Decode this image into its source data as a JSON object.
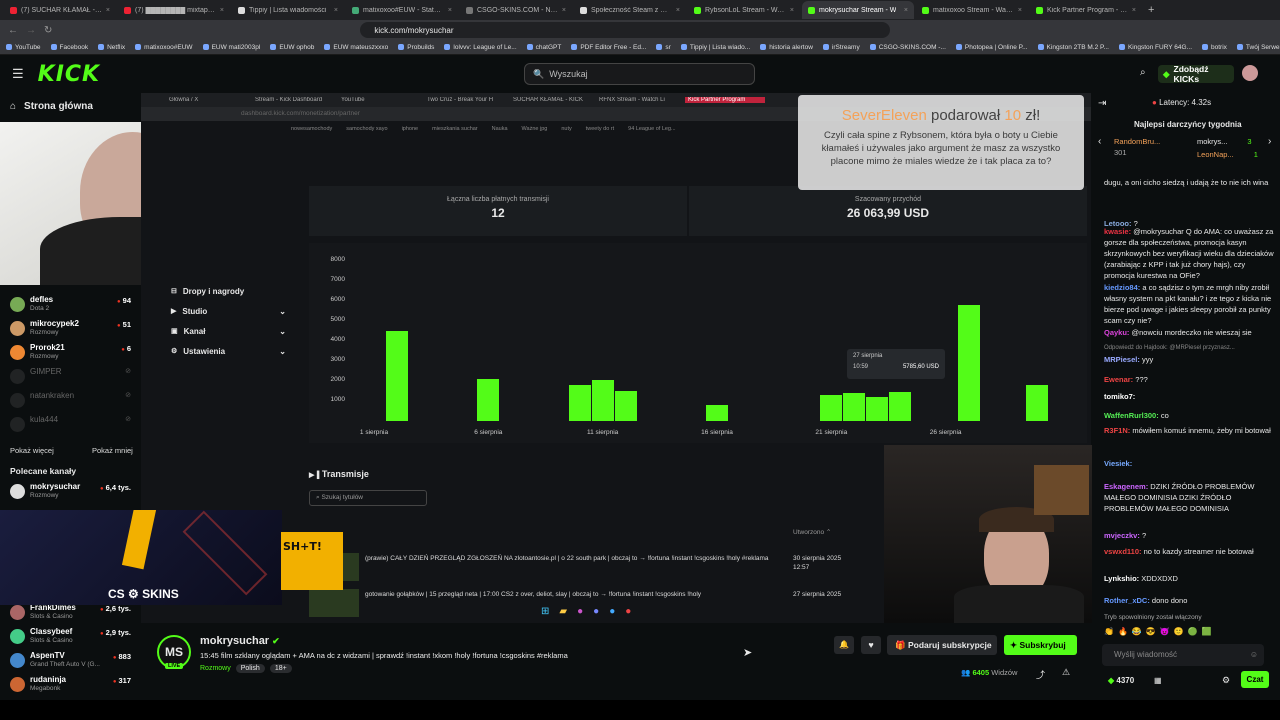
{
  "browser": {
    "tabs": [
      {
        "label": "(7) SUCHAR KŁAMAŁ - KICK PLAY",
        "color": "#e23",
        "active": false
      },
      {
        "label": "(7) ████████ mixtape do",
        "color": "#e23",
        "active": false
      },
      {
        "label": "Tippiy | Lista wiadomości",
        "color": "#ddd",
        "active": false
      },
      {
        "label": "matixoxoo#EUW - Statystyki gry",
        "color": "#4a7",
        "active": false
      },
      {
        "label": "CSGO-SKINS.COM - Najlepsze S",
        "color": "#777",
        "active": false
      },
      {
        "label": "Społeczność Steam z matixoxo",
        "color": "#ddd",
        "active": false
      },
      {
        "label": "RybsonLoL Stream - Watch Live",
        "color": "#53fc18",
        "active": false
      },
      {
        "label": "mokrysuchar Stream - W",
        "color": "#53fc18",
        "active": true
      },
      {
        "label": "matixoxoo Stream - Watch Live",
        "color": "#53fc18",
        "active": false
      },
      {
        "label": "Kick Partner Program - Kick Da",
        "color": "#53fc18",
        "active": false
      }
    ],
    "url": "kick.com/mokrysuchar",
    "bookmarks": [
      "YouTube",
      "Facebook",
      "Netflix",
      "matixoxoo#EUW",
      "EUW mati2003pl",
      "EUW ophob",
      "EUW mateuszxxxo",
      "Probuilds",
      "lolvvv: League of Le...",
      "chatGPT",
      "PDF Editor Free - Ed...",
      "sr",
      "Tippiy | Lista wiado...",
      "historia alertow",
      "irStreamy",
      "CSGO-SKINS.COM -...",
      "Photopea | Online P...",
      "Kingston 2TB M.2 P...",
      "Kingston FURY 64G...",
      "botrix",
      "Twój Serwer - SkillH..."
    ]
  },
  "topbar": {
    "logo": "KICK",
    "search_placeholder": "Wyszukaj",
    "get_kicks": "Zdobądź KICKs"
  },
  "sidebar": {
    "home": "Strona główna",
    "followed": [
      {
        "name": "defles",
        "category": "Dota 2",
        "viewers": "94",
        "color": "#7a5"
      },
      {
        "name": "mikrocypek2",
        "category": "Rozmowy",
        "viewers": "51",
        "color": "#c96"
      },
      {
        "name": "Prorok21",
        "category": "Rozmowy",
        "viewers": "6",
        "color": "#e83"
      },
      {
        "name": "GIMPER",
        "category": "",
        "viewers": "",
        "color": "#444"
      },
      {
        "name": "natankraken",
        "category": "",
        "viewers": "",
        "color": "#444"
      },
      {
        "name": "kula444",
        "category": "",
        "viewers": "",
        "color": "#444"
      }
    ],
    "show_more": "Pokaż więcej",
    "show_less": "Pokaż mniej",
    "recommended_title": "Polecane kanały",
    "recommended": [
      {
        "name": "mokrysuchar",
        "category": "Rozmowy",
        "viewers": "6,4 tys.",
        "color": "#ddd"
      },
      {
        "name": "FrankDimes",
        "category": "Slots & Casino",
        "viewers": "2,6 tys.",
        "color": "#a66"
      },
      {
        "name": "Classybeef",
        "category": "Slots & Casino",
        "viewers": "2,9 tys.",
        "color": "#4c8"
      },
      {
        "name": "AspenTV",
        "category": "Grand Theft Auto V (G...",
        "viewers": "883",
        "color": "#48c"
      },
      {
        "name": "rudaninja",
        "category": "Megabonk",
        "viewers": "317",
        "color": "#c63"
      }
    ]
  },
  "screen": {
    "tabs": [
      "Główna / X",
      "Stream - Kick Dashboard",
      "YouTube",
      "Two Cruz - Break Your H",
      "SUCHAR KŁAMAŁ - KICK",
      "RFNX Stream - Watch Li",
      "Kick Partner Program"
    ],
    "url": "dashboard.kick.com/monetization/partner",
    "bookmarks": [
      "nowesamochody",
      "samochody xayo",
      "iphone",
      "mieszkania suchar",
      "Nauka",
      "Ważne jpg",
      "nuty",
      "tweety do rt",
      "94 League of Leg..."
    ],
    "menu": [
      "Dropy i nagrody",
      "Studio",
      "Kanał",
      "Ustawienia"
    ],
    "stat1_label": "Łączna liczba płatnych transmisji",
    "stat1_value": "12",
    "stat2_label": "Szacowany przychód",
    "stat2_value": "26 063,99 USD",
    "tooltip_date": "27 sierpnia",
    "tooltip_time": "10:59",
    "tooltip_value": "5785,60 USD",
    "transmisje_title": "Transmisje",
    "search_titles": "Szukaj tytułów",
    "created_header": "Utworzono",
    "streams": [
      {
        "title": "(prawie) CAŁY DZIEŃ PRZEGLĄD ZGŁOSZEŃ NA zlotoantosie.pl | o 22 south park | obczaj to → !fortuna !instant !csgoskins !holy #reklama",
        "date": "30 sierpnia 2025",
        "time": "12:57"
      },
      {
        "title": "gotowanie gołąbków | 15 przegląd neta | 17:00 CS2 z over, deliot, slay | obczaj to → !fortuna !instant !csgoskins !holy",
        "date": "27 sierpnia 2025",
        "time": ""
      }
    ]
  },
  "chart_data": {
    "type": "bar",
    "title": "",
    "xlabel": "",
    "ylabel": "",
    "ylim": [
      0,
      8000
    ],
    "yticks": [
      1000,
      2000,
      3000,
      4000,
      5000,
      6000,
      7000,
      8000
    ],
    "xtick_labels": [
      "1 sierpnia",
      "6 sierpnia",
      "11 sierpnia",
      "16 sierpnia",
      "21 sierpnia",
      "26 sierpnia"
    ],
    "series": [
      {
        "values": [
          {
            "day": 2,
            "value": 4500
          },
          {
            "day": 6,
            "value": 2100
          },
          {
            "day": 10,
            "value": 1800
          },
          {
            "day": 11,
            "value": 2050
          },
          {
            "day": 12,
            "value": 1500
          },
          {
            "day": 16,
            "value": 800
          },
          {
            "day": 21,
            "value": 1300
          },
          {
            "day": 22,
            "value": 1400
          },
          {
            "day": 23,
            "value": 1200
          },
          {
            "day": 24,
            "value": 1450
          },
          {
            "day": 27,
            "value": 5785.6
          },
          {
            "day": 30,
            "value": 1800
          }
        ]
      }
    ]
  },
  "donation": {
    "name": "SeverEleven",
    "action": "podarował",
    "amount": "10",
    "currency": "zł!",
    "message": "Czyli cała spine z Rybsonem, która była o boty u Ciebie kłamałeś i używales jako argument że masz za wszystko placone mimo że miales wiedze że i tak placa za to?"
  },
  "overlay": {
    "logo": "CS",
    "skins": "SKINS"
  },
  "stream": {
    "channel": "mokrysuchar",
    "avatar_initials": "MS",
    "live_badge": "LIVE",
    "title": "15:45 film szklany oglądam + AMA na dc z widzami | sprawdź !instant !xkom !holy !fortuna !csgoskins #reklama",
    "category": "Rozmowy",
    "tags": [
      "Polish",
      "18+"
    ],
    "gift_label": "Podaruj subskrypcje",
    "subscribe_label": "Subskrybuj",
    "viewers": "6405",
    "viewers_label": "Widzów"
  },
  "chat": {
    "latency": "Latency: 4.32s",
    "top_title": "Najlepsi darczyńcy tygodnia",
    "top": [
      {
        "name": "RandomBru...",
        "value": "301"
      },
      {
        "name": "mokrys...",
        "value": "3"
      },
      {
        "name": "LeonNap...",
        "value": "1"
      }
    ],
    "messages": [
      {
        "user": "",
        "color": "#fff",
        "text": "dugu, a oni cicho siedzą i udają że to nie ich wina"
      },
      {
        "user": "Letooo:",
        "color": "#8ad",
        "text": "?"
      },
      {
        "user": "kwasie:",
        "color": "#e34",
        "text": "@mokrysuchar Q do AMA: co uważasz za gorsze dla społeczeństwa, promocja kasyn skrzynkowych bez weryfikacji wieku dla dzieciaków (zarabiając z KPP i tak już chory hajs), czy promocja kurestwa na OFie?"
      },
      {
        "user": "kiedzio84:",
        "color": "#69f",
        "text": "a co sądzisz o tym ze mrgh niby zrobił własny system na pkt kanału? i ze tego z kicka nie bierze pod uwage i jakies sleepy porobił za punkty scam czy nie?"
      },
      {
        "user": "Qayku:",
        "color": "#d4d",
        "text": "@nowciu mordeczko nie wieszaj sie"
      },
      {
        "user": "MRPiesel:",
        "color": "#9af",
        "text": "yyy"
      },
      {
        "user": "Ewenar:",
        "color": "#e44",
        "text": "???"
      },
      {
        "user": "tomiko7:",
        "color": "#fff",
        "text": ""
      },
      {
        "user": "WaffenRurl300:",
        "color": "#5e5",
        "text": "co"
      },
      {
        "user": "R3F1N:",
        "color": "#e44",
        "text": "mówiłem komuś innemu, żeby mi botował"
      },
      {
        "user": "Viesiek:",
        "color": "#7af",
        "text": ""
      },
      {
        "user": "Eskagenem:",
        "color": "#c6f",
        "text": "DZIKI ŹRÓDŁO PROBLEMÓW MAŁEGO DOMINISIA DZIKI ŹRÓDŁO PROBLEMÓW MAŁEGO DOMINISIA"
      },
      {
        "user": "mvjeczkv:",
        "color": "#c6f",
        "text": "?"
      },
      {
        "user": "vswxd110:",
        "color": "#e44",
        "text": "no to kazdy streamer nie botował"
      },
      {
        "user": "Lynkshio:",
        "color": "#fff",
        "text": "XDDXDXD"
      },
      {
        "user": "Rother_xDC:",
        "color": "#69f",
        "text": "dono dono"
      }
    ],
    "reply_hint": "Odpowiedź do Hajdook: @MRPiesel przyznasz...",
    "slow_mode": "Tryb spowolniony został włączony",
    "input_placeholder": "Wyślij wiadomość",
    "points": "4370",
    "chat_button": "Czat"
  }
}
